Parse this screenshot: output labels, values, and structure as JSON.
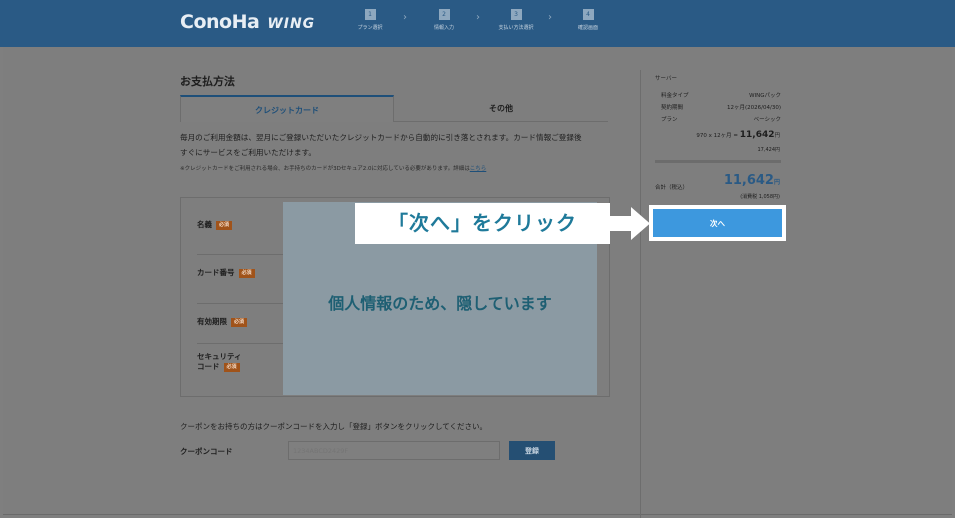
{
  "header": {
    "logo_main": "ConoHa",
    "logo_sub": "WING",
    "steps": [
      {
        "num": "1",
        "label": "プラン選択"
      },
      {
        "num": "2",
        "label": "情報入力"
      },
      {
        "num": "3",
        "label": "支払い方法選択"
      },
      {
        "num": "4",
        "label": "確認画面"
      }
    ]
  },
  "main": {
    "title": "お支払方法",
    "tabs": [
      {
        "label": "クレジットカード"
      },
      {
        "label": "その他"
      }
    ],
    "description_line1": "毎月のご利用金額は、翌月にご登録いただいたクレジットカードから自動的に引き落とされます。カード情報ご登録後",
    "description_line2": "すぐにサービスをご利用いただけます。",
    "note": "※クレジットカードをご利用される場合、お手持ちのカードが3Dセキュア2.0に対応している必要があります。詳細は",
    "note_link": "こちら",
    "form": {
      "required_badge": "必須",
      "fields": [
        {
          "label": "名義"
        },
        {
          "label": "カード番号"
        },
        {
          "label": "有効期限"
        },
        {
          "label_line1": "セキュリティ",
          "label_line2": "コード"
        }
      ],
      "hidden_notice": "個人情報のため、隠しています"
    },
    "coupon": {
      "description": "クーポンをお持ちの方はクーポンコードを入力し「登録」ボタンをクリックしてください。",
      "label": "クーポンコード",
      "placeholder": "1234ABCD2429F",
      "button_label": "登録"
    }
  },
  "sidebar": {
    "title": "サーバー",
    "rows": [
      {
        "key": "料金タイプ",
        "value": "WINGパック"
      },
      {
        "key": "契約期間",
        "value": "12ヶ月(2026/04/30)"
      },
      {
        "key": "プラン",
        "value": "ベーシック"
      }
    ],
    "calc_prefix": "970 x 12ヶ月 =",
    "calc_amount": "11,642",
    "calc_yen": "円",
    "calc_sub": "17,424円",
    "total_label": "合計（税込）",
    "total_amount": "11,642",
    "total_yen": "円",
    "total_tax": "(消費税 1,058円)",
    "next_button": "次へ"
  },
  "annotation": {
    "callout": "「次へ」をクリック"
  },
  "colors": {
    "header_bg": "#2a5a85",
    "next_button": "#3d98de",
    "callout_text": "#1f7a9a",
    "required_badge": "#a0531a"
  }
}
